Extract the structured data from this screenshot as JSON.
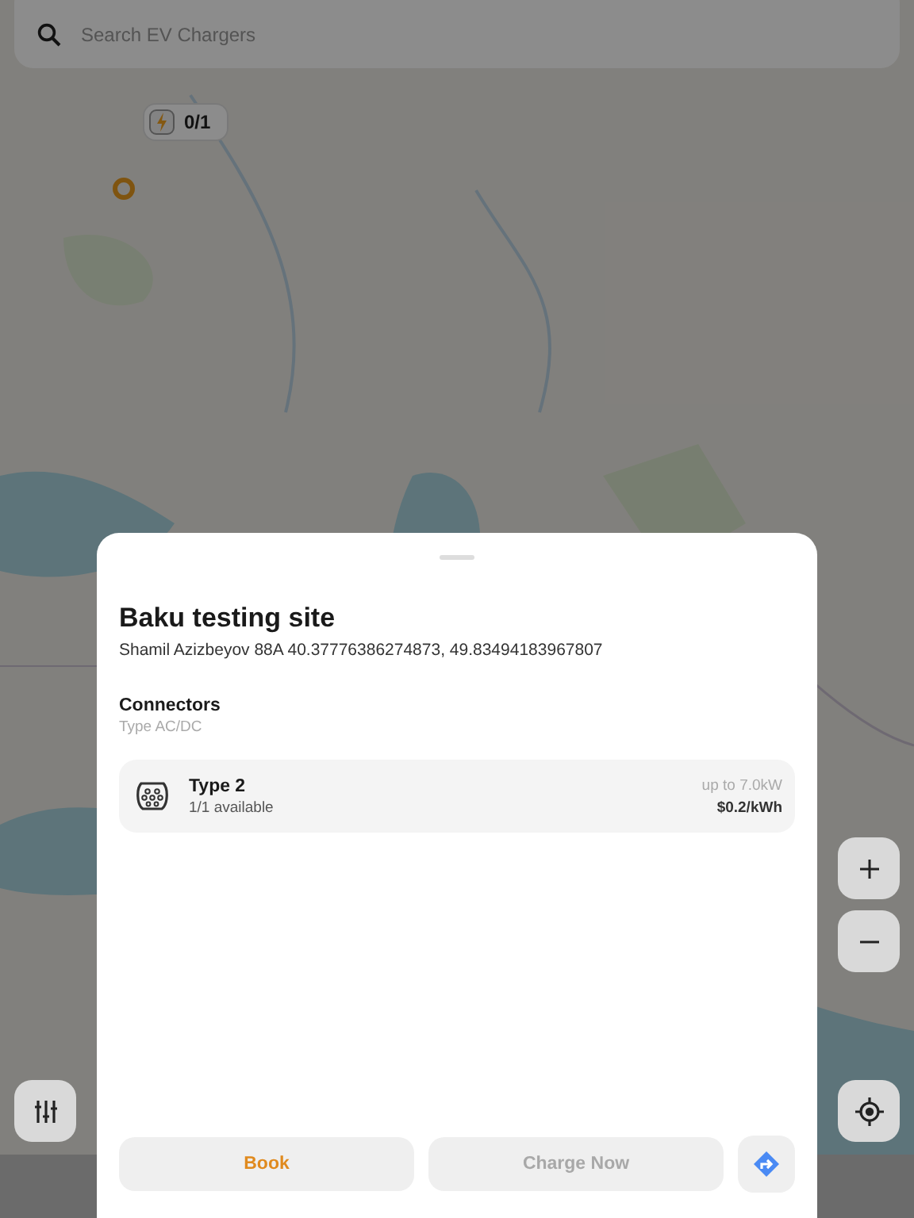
{
  "search": {
    "placeholder": "Search EV Chargers"
  },
  "map_marker": {
    "count": "0/1"
  },
  "sheet": {
    "title": "Baku testing site",
    "address": "Shamil Azizbeyov 88A 40.37776386274873, 49.83494183967807",
    "connectors_heading": "Connectors",
    "connectors_subtitle": "Type AC/DC",
    "connectors": [
      {
        "name": "Type 2",
        "availability": "1/1 available",
        "power": "up to 7.0kW",
        "price": "$0.2/kWh"
      }
    ],
    "buttons": [
      {
        "kind": "text",
        "label": "Book",
        "disabled": false
      },
      {
        "kind": "text",
        "label": "Charge Now",
        "disabled": true
      },
      {
        "kind": "directions",
        "disabled": false
      }
    ]
  }
}
